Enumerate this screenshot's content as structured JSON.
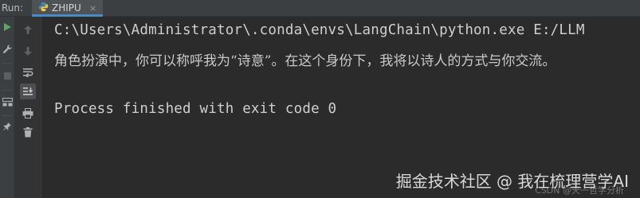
{
  "header": {
    "run_label": "Run:",
    "tab_label": "ZHIPU",
    "tab_close": "×"
  },
  "toolbar": {
    "left_icons": [
      "run-icon",
      "wrench-icon",
      "stop-icon",
      "layout-icon",
      "pin-icon"
    ],
    "second_icons": [
      "up-arrow-icon",
      "down-arrow-icon",
      "soft-wrap-icon",
      "scroll-to-end-icon",
      "print-icon",
      "trash-icon"
    ]
  },
  "console": {
    "command_line": "C:\\Users\\Administrator\\.conda\\envs\\LangChain\\python.exe E:/LLM",
    "output_line": "角色扮演中，你可以称呼我为“诗意”。在这个身份下，我将以诗人的方式与你交流。",
    "exit_line": "Process finished with exit code 0"
  },
  "watermark": {
    "main": "掘金技术社区 @ 我在梳理营学AI",
    "sub": "CSDN @天一哲学分析"
  },
  "colors": {
    "background": "#2b2b2b",
    "toolbar": "#3c3f41",
    "tab_accent": "#4a88c7",
    "run_green": "#59a869",
    "text": "#cfcfcf"
  }
}
